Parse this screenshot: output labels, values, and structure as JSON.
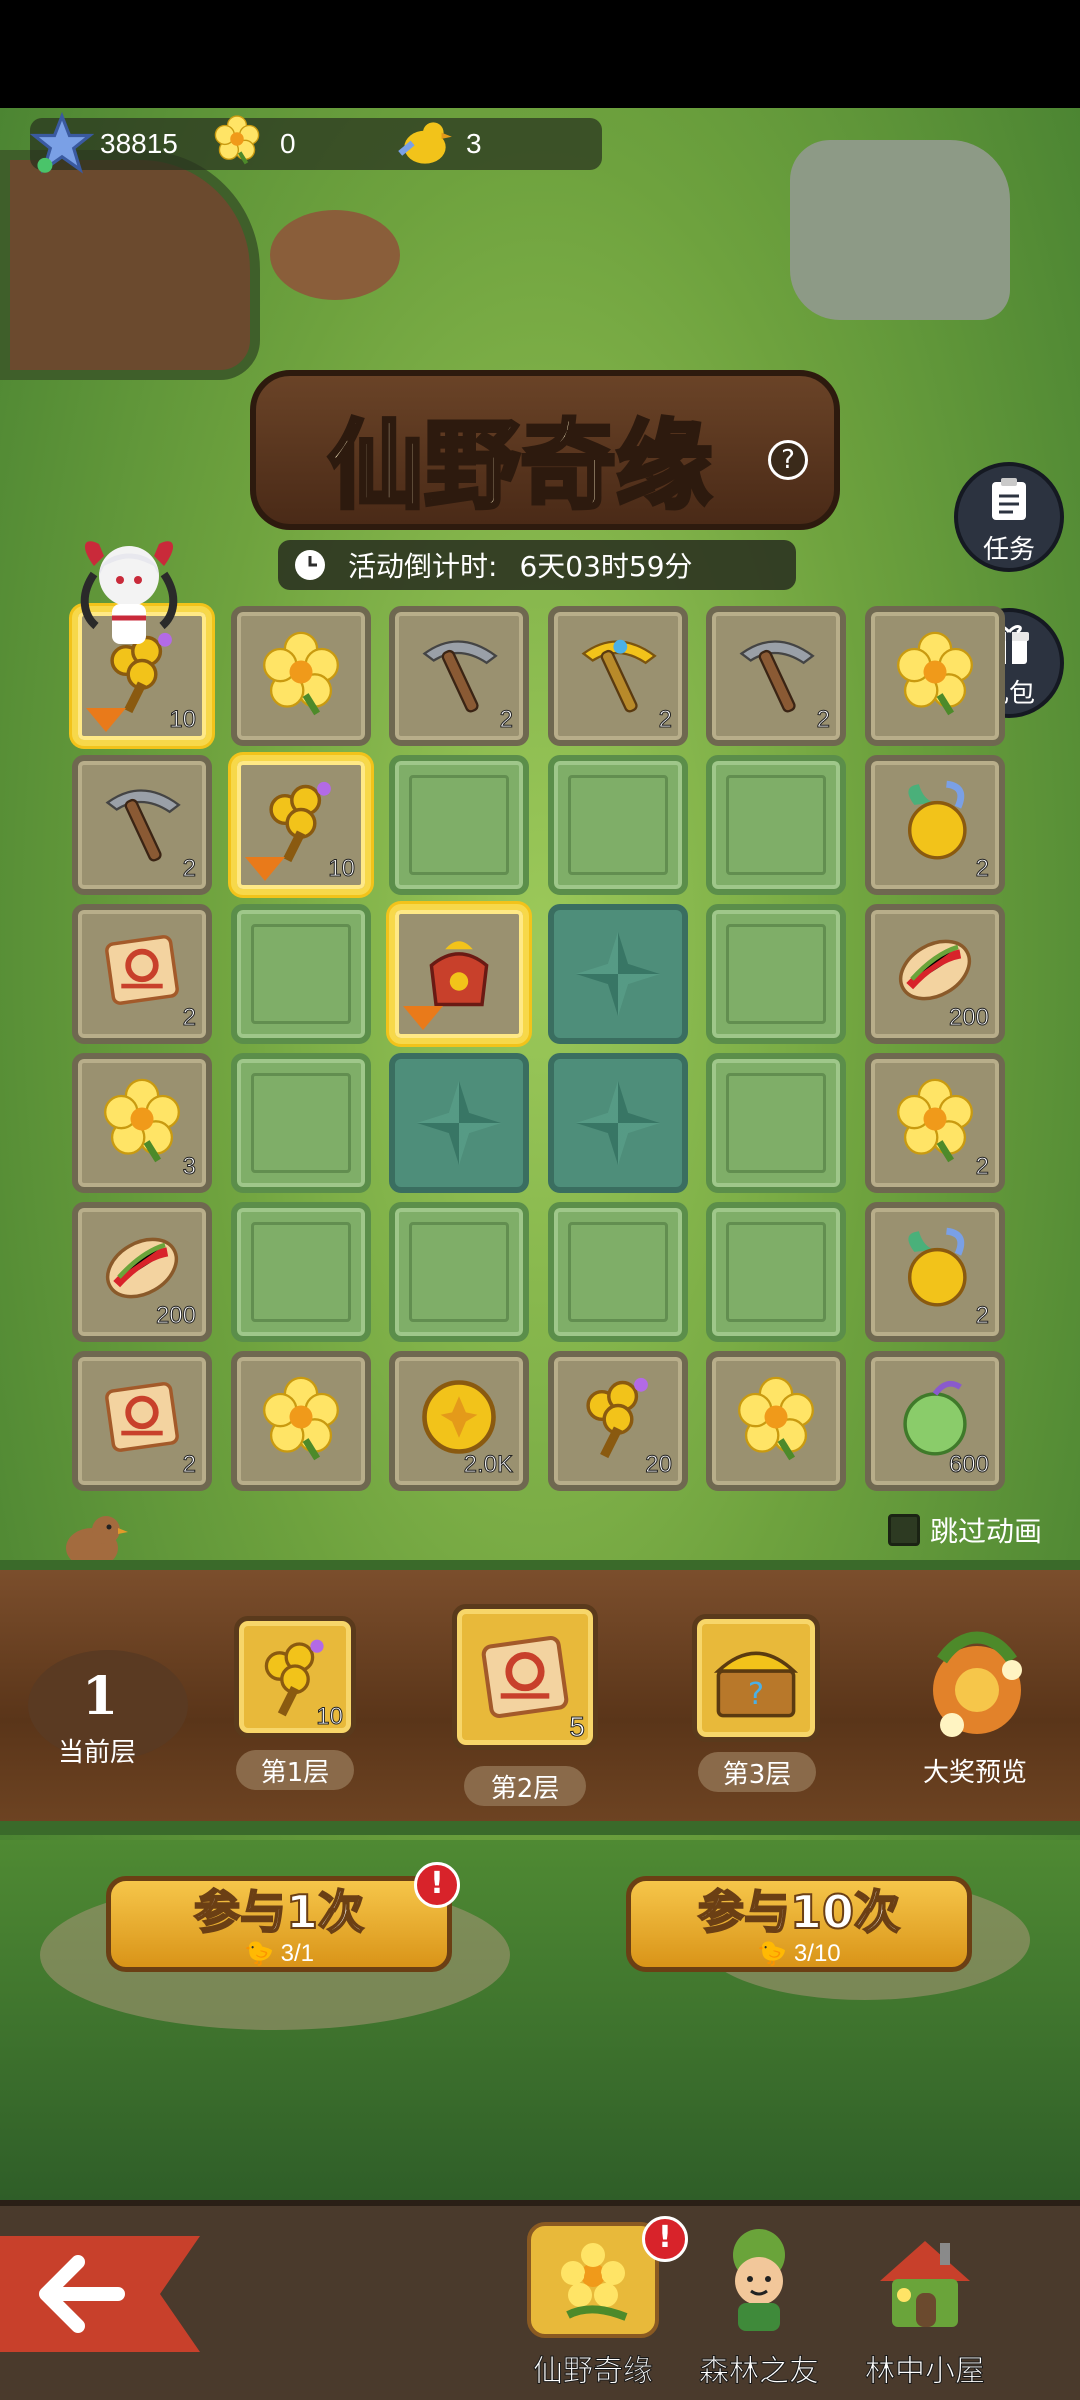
{
  "resources": [
    {
      "icon": "star-currency-icon",
      "value": "38815"
    },
    {
      "icon": "yellow-flower-icon",
      "value": "0"
    },
    {
      "icon": "bird-ticket-icon",
      "value": "3"
    }
  ],
  "event": {
    "title": "仙野奇缘",
    "help_label": "?",
    "countdown_label": "活动倒计时:",
    "countdown_value": "6天03时59分"
  },
  "side_buttons": [
    {
      "label": "任务",
      "icon": "clipboard-icon"
    },
    {
      "label": "礼包",
      "icon": "gift-icon"
    }
  ],
  "board": {
    "rows": [
      [
        {
          "type": "item",
          "icon": "wind-up-key-icon",
          "count": "10",
          "selected": true,
          "arrow": true
        },
        {
          "type": "item",
          "icon": "yellow-flower-icon",
          "count": ""
        },
        {
          "type": "item",
          "icon": "iron-pickaxe-icon",
          "count": "2"
        },
        {
          "type": "item",
          "icon": "golden-pickaxe-icon",
          "count": "2"
        },
        {
          "type": "item",
          "icon": "iron-pickaxe-icon",
          "count": "2"
        },
        {
          "type": "item",
          "icon": "yellow-flower-icon",
          "count": ""
        }
      ],
      [
        {
          "type": "item",
          "icon": "iron-pickaxe-icon",
          "count": "2"
        },
        {
          "type": "item",
          "icon": "wind-up-key-icon",
          "count": "10",
          "selected": true,
          "arrow": true
        },
        {
          "type": "empty"
        },
        {
          "type": "empty"
        },
        {
          "type": "empty"
        },
        {
          "type": "item",
          "icon": "golden-lamp-icon",
          "count": "2"
        }
      ],
      [
        {
          "type": "item",
          "icon": "scroll-icon",
          "count": "2"
        },
        {
          "type": "empty"
        },
        {
          "type": "item",
          "icon": "gift-bag-icon",
          "count": "",
          "selected": true,
          "arrow": true
        },
        {
          "type": "teal"
        },
        {
          "type": "empty"
        },
        {
          "type": "item",
          "icon": "sandwich-icon",
          "count": "200"
        }
      ],
      [
        {
          "type": "item",
          "icon": "yellow-flower-icon",
          "count": "3"
        },
        {
          "type": "empty"
        },
        {
          "type": "teal"
        },
        {
          "type": "teal"
        },
        {
          "type": "empty"
        },
        {
          "type": "item",
          "icon": "yellow-flower-icon",
          "count": "2"
        }
      ],
      [
        {
          "type": "item",
          "icon": "sandwich-icon",
          "count": "200"
        },
        {
          "type": "empty"
        },
        {
          "type": "empty"
        },
        {
          "type": "empty"
        },
        {
          "type": "empty"
        },
        {
          "type": "item",
          "icon": "golden-lamp-icon",
          "count": "2"
        }
      ],
      [
        {
          "type": "item",
          "icon": "scroll-icon",
          "count": "2"
        },
        {
          "type": "item",
          "icon": "yellow-flower-icon",
          "count": ""
        },
        {
          "type": "item",
          "icon": "gold-coin-icon",
          "count": "2.0K"
        },
        {
          "type": "item",
          "icon": "wind-up-key-icon",
          "count": "20"
        },
        {
          "type": "item",
          "icon": "yellow-flower-icon",
          "count": ""
        },
        {
          "type": "item",
          "icon": "green-fruit-icon",
          "count": "600"
        }
      ]
    ]
  },
  "skip_animation": {
    "label": "跳过动画",
    "checked": false
  },
  "floors": {
    "current_number": "1",
    "current_label": "当前层",
    "prizes": [
      {
        "icon": "wind-up-key-icon",
        "count": "10",
        "label": "第1层"
      },
      {
        "icon": "scroll-icon",
        "count": "5",
        "label": "第2层"
      },
      {
        "icon": "treasure-chest-icon",
        "count": "",
        "label": "第3层"
      }
    ],
    "grand_prize_label": "大奖预览"
  },
  "actions": [
    {
      "label": "参与1次",
      "cost": "3/1",
      "badge": "!"
    },
    {
      "label": "参与10次",
      "cost": "3/10"
    }
  ],
  "bottom_nav": [
    {
      "label": "仙野奇缘",
      "icon": "flower-event-icon",
      "active": true,
      "badge": "!"
    },
    {
      "label": "森林之友",
      "icon": "forest-friend-icon"
    },
    {
      "label": "林中小屋",
      "icon": "cottage-icon"
    }
  ],
  "colors": {
    "accent": "#f2c31a",
    "button": "#e0a22a",
    "badge": "#d8232a"
  }
}
